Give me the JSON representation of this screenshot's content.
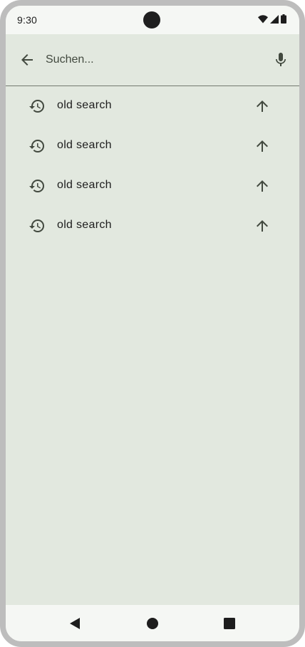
{
  "status_bar": {
    "time": "9:30",
    "icons": [
      "wifi-icon",
      "signal-icon",
      "battery-icon"
    ]
  },
  "search": {
    "placeholder": "Suchen...",
    "value": "",
    "back_icon": "arrow-back-icon",
    "mic_icon": "mic-icon"
  },
  "suggestions": [
    {
      "label": "old search",
      "icon": "history-icon",
      "action_icon": "arrow-up-icon"
    },
    {
      "label": "old search",
      "icon": "history-icon",
      "action_icon": "arrow-up-icon"
    },
    {
      "label": "old search",
      "icon": "history-icon",
      "action_icon": "arrow-up-icon"
    },
    {
      "label": "old search",
      "icon": "history-icon",
      "action_icon": "arrow-up-icon"
    }
  ],
  "nav_bar": {
    "buttons": [
      "back-triangle-icon",
      "home-circle-icon",
      "recents-square-icon"
    ]
  },
  "colors": {
    "surface": "#e2e8df",
    "status_bar": "#f5f7f4",
    "frame": "#bdbdbd",
    "text": "#1d1d1d",
    "divider": "#73796f"
  }
}
